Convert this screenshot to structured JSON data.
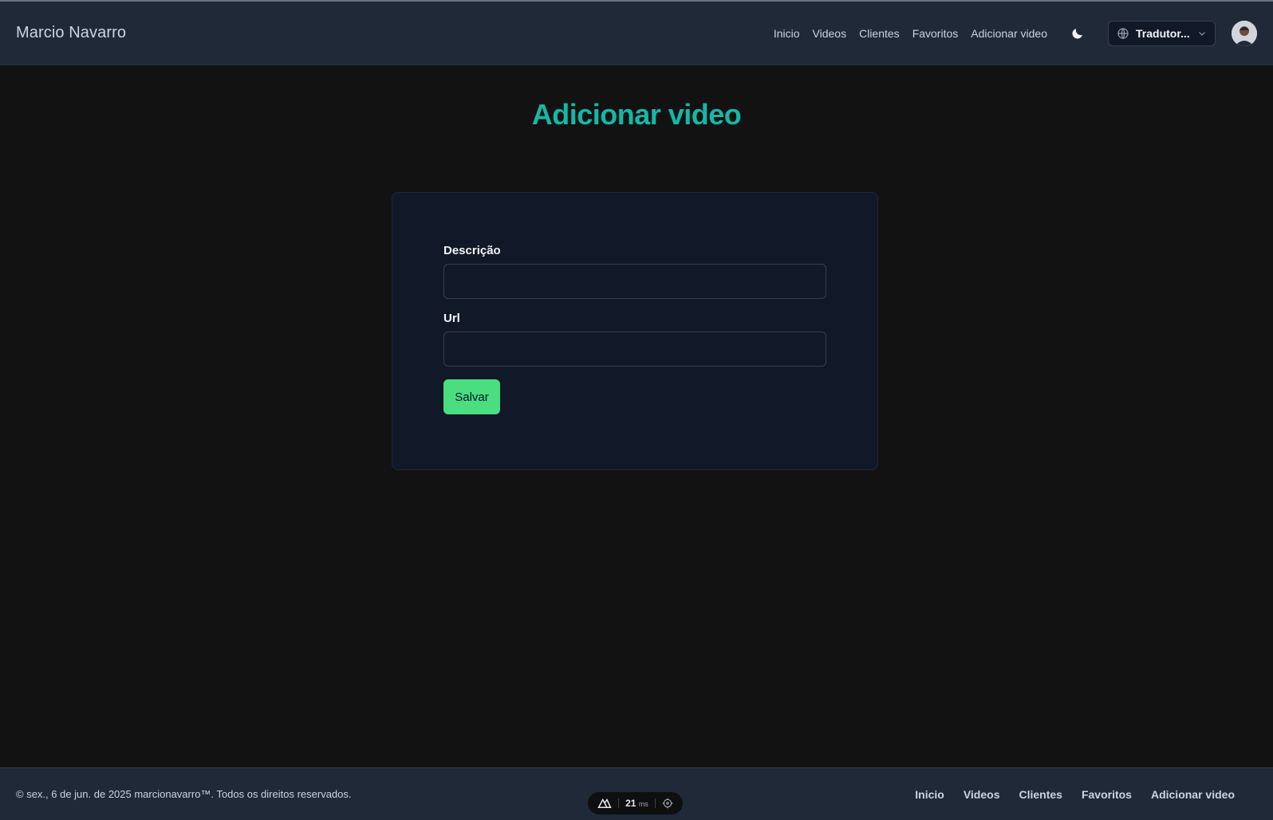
{
  "header": {
    "brand": "Marcio Navarro",
    "nav": [
      "Inicio",
      "Videos",
      "Clientes",
      "Favoritos",
      "Adicionar video"
    ],
    "theme_icon": "moon-icon",
    "translator_label": "Tradutor...",
    "translator_icon": "globe-icon",
    "avatar_icon": "user-avatar"
  },
  "main": {
    "title": "Adicionar video",
    "form": {
      "description_label": "Descrição",
      "description_value": "",
      "url_label": "Url",
      "url_value": "",
      "save_label": "Salvar"
    }
  },
  "footer": {
    "copyright": "© sex., 6 de jun. de 2025 marcionavarro™. Todos os direitos reservados.",
    "nav": [
      "Inicio",
      "Videos",
      "Clientes",
      "Favoritos",
      "Adicionar video"
    ]
  },
  "devtools": {
    "ms_value": "21",
    "ms_unit": "ms",
    "logo_icon": "nuxt-icon",
    "target_icon": "crosshair-icon"
  },
  "colors": {
    "accent": "#14b8a6",
    "button": "#4ade80",
    "header_bg": "#1f2937",
    "page_bg": "#121212",
    "card_bg": "#111827"
  }
}
